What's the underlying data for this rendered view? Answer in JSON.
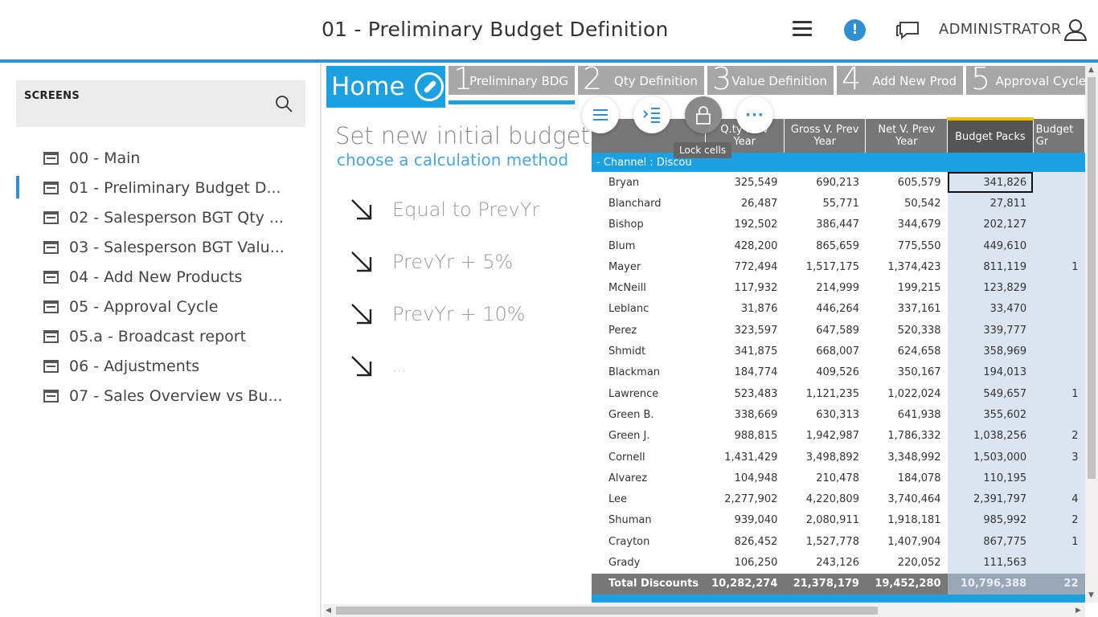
{
  "header": {
    "title": "01 - Preliminary Budget Definition",
    "user": "ADMINISTRATOR",
    "alert_glyph": "!"
  },
  "sidebar": {
    "screens_label": "SCREENS",
    "items": [
      {
        "label": "00 - Main"
      },
      {
        "label": "01 - Preliminary Budget D..."
      },
      {
        "label": "02 - Salesperson BGT Qty ..."
      },
      {
        "label": "03 - Salesperson BGT Valu..."
      },
      {
        "label": "04 - Add New Products"
      },
      {
        "label": "05 - Approval Cycle"
      },
      {
        "label": "05.a - Broadcast report"
      },
      {
        "label": "06 - Adjustments"
      },
      {
        "label": "07 - Sales Overview vs Bu..."
      }
    ]
  },
  "tabs": {
    "home": "Home",
    "steps": [
      {
        "num": "1",
        "name": "Preliminary BDG"
      },
      {
        "num": "2",
        "name": "Qty Definition"
      },
      {
        "num": "3",
        "name": "Value Definition"
      },
      {
        "num": "4",
        "name": "Add New Prod"
      },
      {
        "num": "5",
        "name": "Approval Cycle"
      }
    ]
  },
  "methods": {
    "title": "Set new initial budget...",
    "subtitle": "choose a calculation method",
    "options": [
      "Equal to PrevYr",
      "PrevYr + 5%",
      "PrevYr + 10%",
      "..."
    ]
  },
  "toolbar": {
    "tooltip": "Lock cells",
    "more_glyph": "···"
  },
  "grid": {
    "columns": [
      "Q.ty Prev Year",
      "Gross V. Prev Year",
      "Net V. Prev Year",
      "Budget Packs",
      "Budget Gr"
    ],
    "channel_label": "-  Channel : Discou",
    "rows": [
      {
        "name": "Bryan",
        "qty": "325,549",
        "gross": "690,213",
        "net": "605,579",
        "budget": "341,826",
        "bg": ""
      },
      {
        "name": "Blanchard",
        "qty": "26,487",
        "gross": "55,771",
        "net": "50,542",
        "budget": "27,811",
        "bg": ""
      },
      {
        "name": "Bishop",
        "qty": "192,502",
        "gross": "386,447",
        "net": "344,679",
        "budget": "202,127",
        "bg": ""
      },
      {
        "name": "Blum",
        "qty": "428,200",
        "gross": "865,659",
        "net": "775,550",
        "budget": "449,610",
        "bg": ""
      },
      {
        "name": "Mayer",
        "qty": "772,494",
        "gross": "1,517,175",
        "net": "1,374,423",
        "budget": "811,119",
        "bg": "1"
      },
      {
        "name": "McNeill",
        "qty": "117,932",
        "gross": "214,999",
        "net": "199,215",
        "budget": "123,829",
        "bg": ""
      },
      {
        "name": "Leblanc",
        "qty": "31,876",
        "gross": "446,264",
        "net": "337,161",
        "budget": "33,470",
        "bg": ""
      },
      {
        "name": "Perez",
        "qty": "323,597",
        "gross": "647,589",
        "net": "520,338",
        "budget": "339,777",
        "bg": ""
      },
      {
        "name": "Shmidt",
        "qty": "341,875",
        "gross": "668,007",
        "net": "624,658",
        "budget": "358,969",
        "bg": ""
      },
      {
        "name": "Blackman",
        "qty": "184,774",
        "gross": "409,526",
        "net": "350,167",
        "budget": "194,013",
        "bg": ""
      },
      {
        "name": "Lawrence",
        "qty": "523,483",
        "gross": "1,121,235",
        "net": "1,022,024",
        "budget": "549,657",
        "bg": "1"
      },
      {
        "name": "Green B.",
        "qty": "338,669",
        "gross": "630,313",
        "net": "641,938",
        "budget": "355,602",
        "bg": ""
      },
      {
        "name": "Green J.",
        "qty": "988,815",
        "gross": "1,942,987",
        "net": "1,786,332",
        "budget": "1,038,256",
        "bg": "2"
      },
      {
        "name": "Cornell",
        "qty": "1,431,429",
        "gross": "3,498,892",
        "net": "3,348,992",
        "budget": "1,503,000",
        "bg": "3"
      },
      {
        "name": "Alvarez",
        "qty": "104,948",
        "gross": "210,478",
        "net": "184,078",
        "budget": "110,195",
        "bg": ""
      },
      {
        "name": "Lee",
        "qty": "2,277,902",
        "gross": "4,220,809",
        "net": "3,740,464",
        "budget": "2,391,797",
        "bg": "4"
      },
      {
        "name": "Shuman",
        "qty": "939,040",
        "gross": "2,080,911",
        "net": "1,918,181",
        "budget": "985,992",
        "bg": "2"
      },
      {
        "name": "Crayton",
        "qty": "826,452",
        "gross": "1,527,778",
        "net": "1,407,904",
        "budget": "867,775",
        "bg": "1"
      },
      {
        "name": "Grady",
        "qty": "106,250",
        "gross": "243,126",
        "net": "220,052",
        "budget": "111,563",
        "bg": ""
      }
    ],
    "total": {
      "name": "Total Discounts",
      "qty": "10,282,274",
      "gross": "21,378,179",
      "net": "19,452,280",
      "budget": "10,796,388",
      "bg": "22"
    }
  },
  "colors": {
    "accent": "#1ba1e2",
    "header_line": "#2f8fd0",
    "step_bg": "#a7a7a7",
    "grid_header": "#777777",
    "budget_cell": "#dbe5f1"
  }
}
